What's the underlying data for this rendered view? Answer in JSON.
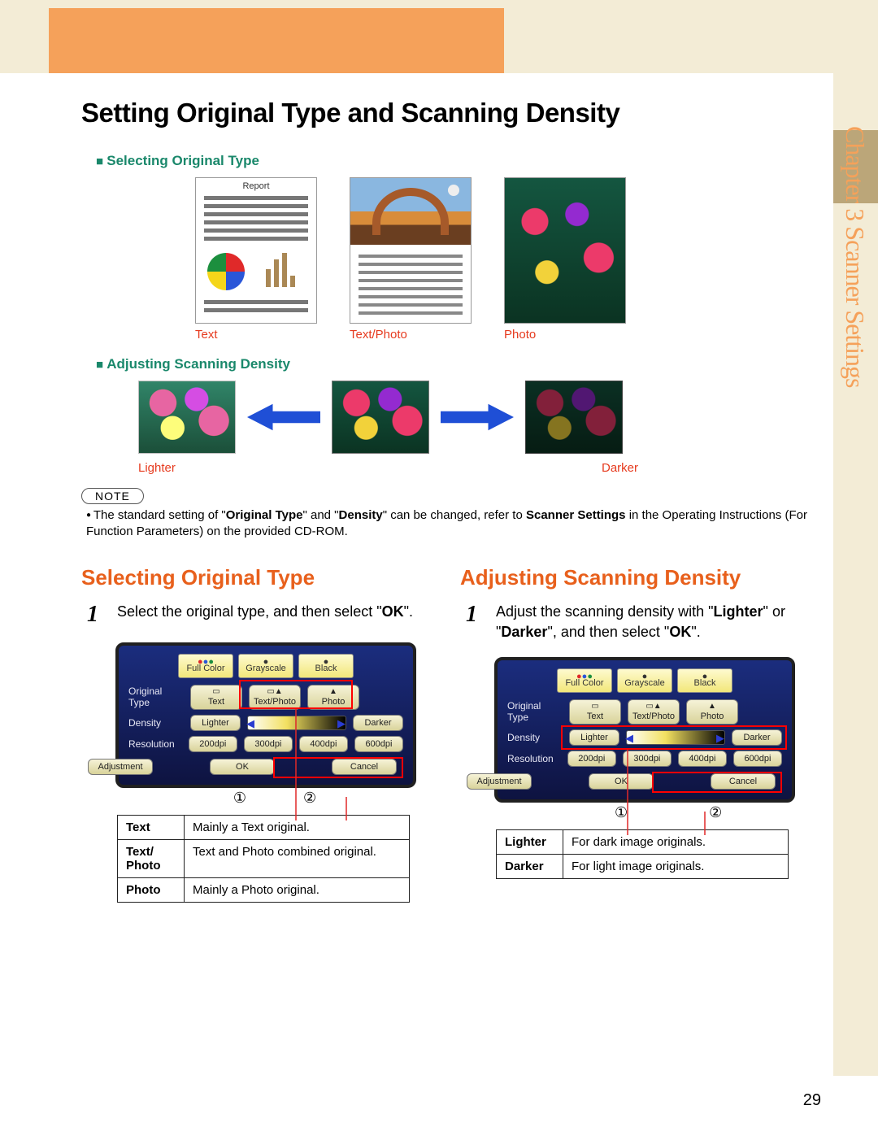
{
  "chapter_sidebar": "Chapter 3   Scanner Settings",
  "page_title": "Setting Original Type and Scanning Density",
  "sq1": "Selecting Original Type",
  "sq2": "Adjusting Scanning Density",
  "report_label": "Report",
  "caps": {
    "text": "Text",
    "textphoto": "Text/Photo",
    "photo": "Photo",
    "lighter": "Lighter",
    "darker": "Darker"
  },
  "note_label": "NOTE",
  "note_plain1": "The standard setting of \"",
  "note_b1": "Original Type",
  "note_plain2": "\" and \"",
  "note_b2": "Density",
  "note_plain3": "\" can be changed, refer to ",
  "note_b3": "Scanner Settings",
  "note_plain4": " in the Operating Instructions (For Function Parameters) on the provided CD-ROM.",
  "colA": {
    "heading": "Selecting Original Type",
    "step_pre": "Select the original type, and then select \"",
    "step_bold": "OK",
    "step_post": "\".",
    "call1": "①",
    "call2": "②",
    "table": [
      {
        "k": "Text",
        "v": "Mainly a Text original."
      },
      {
        "k": "Text/ Photo",
        "v": "Text and Photo combined original."
      },
      {
        "k": "Photo",
        "v": "Mainly a Photo original."
      }
    ]
  },
  "colB": {
    "heading": "Adjusting Scanning Density",
    "step_pre": "Adjust the scanning density with \"",
    "step_b1": "Lighter",
    "step_mid": "\" or \"",
    "step_b2": "Darker",
    "step_mid2": "\", and then select \"",
    "step_b3": "OK",
    "step_post": "\".",
    "call1": "①",
    "call2": "②",
    "table": [
      {
        "k": "Lighter",
        "v": "For dark image originals."
      },
      {
        "k": "Darker",
        "v": "For light image originals."
      }
    ]
  },
  "panel": {
    "tabs": [
      "Full Color",
      "Grayscale",
      "Black"
    ],
    "rows": {
      "originalType": "Original Type",
      "density": "Density",
      "resolution": "Resolution",
      "adjustment": "Adjustment"
    },
    "otype": [
      "Text",
      "Text/Photo",
      "Photo"
    ],
    "dens": {
      "lighter": "Lighter",
      "darker": "Darker"
    },
    "res": [
      "200dpi",
      "300dpi",
      "400dpi",
      "600dpi"
    ],
    "ok": "OK",
    "cancel": "Cancel"
  },
  "page_number": "29"
}
